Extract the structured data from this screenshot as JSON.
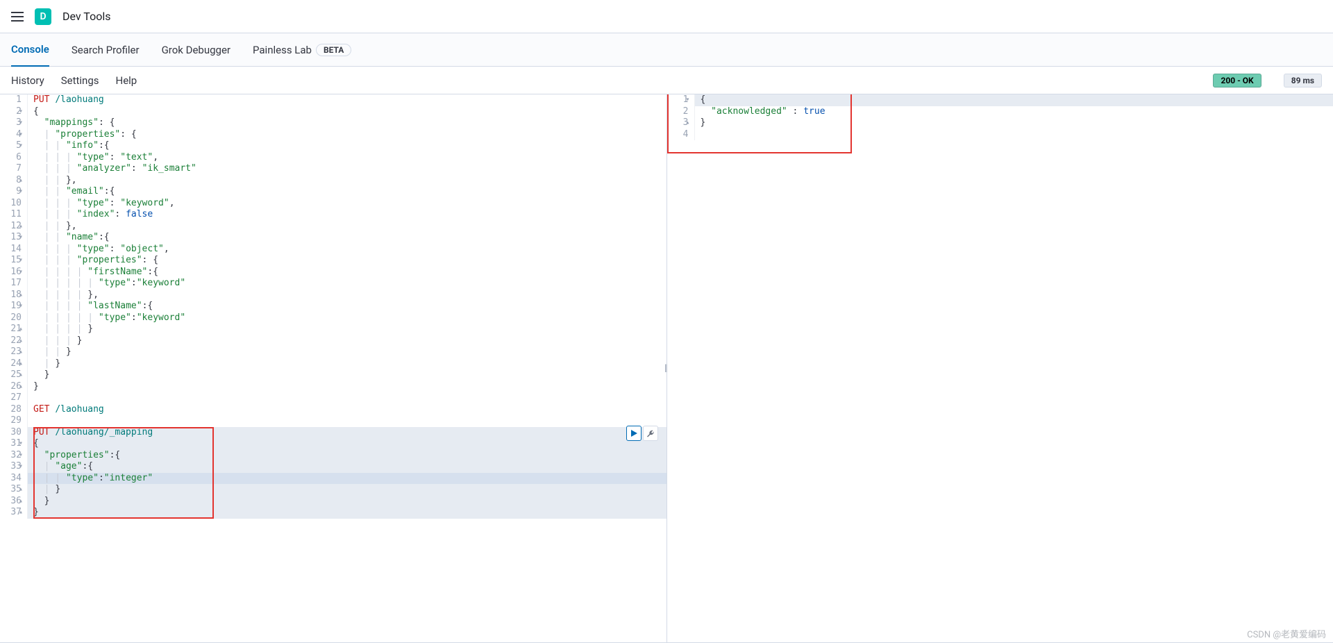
{
  "header": {
    "app_icon_letter": "D",
    "app_title": "Dev Tools"
  },
  "tabs": [
    {
      "label": "Console",
      "active": true
    },
    {
      "label": "Search Profiler",
      "active": false
    },
    {
      "label": "Grok Debugger",
      "active": false
    },
    {
      "label": "Painless Lab",
      "active": false,
      "badge": "BETA"
    }
  ],
  "subbar": {
    "history": "History",
    "settings": "Settings",
    "help": "Help",
    "status_label": "200 - OK",
    "timing_label": "89 ms"
  },
  "request_editor": {
    "highlight_start_line": 30,
    "highlight_end_line": 37,
    "current_line": 34,
    "lines": [
      {
        "n": 1,
        "fold": "",
        "tokens": [
          [
            "method",
            "PUT "
          ],
          [
            "path",
            "/laohuang"
          ]
        ]
      },
      {
        "n": 2,
        "fold": "▾",
        "tokens": [
          [
            "punct",
            "{"
          ]
        ]
      },
      {
        "n": 3,
        "fold": "▾",
        "tokens": [
          [
            "guide",
            "  "
          ],
          [
            "key",
            "\"mappings\""
          ],
          [
            "punct",
            ": {"
          ]
        ]
      },
      {
        "n": 4,
        "fold": "▾",
        "tokens": [
          [
            "guide",
            "  | "
          ],
          [
            "key",
            "\"properties\""
          ],
          [
            "punct",
            ": {"
          ]
        ]
      },
      {
        "n": 5,
        "fold": "▾",
        "tokens": [
          [
            "guide",
            "  | | "
          ],
          [
            "key",
            "\"info\""
          ],
          [
            "punct",
            ":{"
          ]
        ]
      },
      {
        "n": 6,
        "fold": "",
        "tokens": [
          [
            "guide",
            "  | | | "
          ],
          [
            "key",
            "\"type\""
          ],
          [
            "punct",
            ": "
          ],
          [
            "str",
            "\"text\""
          ],
          [
            "punct",
            ","
          ]
        ]
      },
      {
        "n": 7,
        "fold": "",
        "tokens": [
          [
            "guide",
            "  | | | "
          ],
          [
            "key",
            "\"analyzer\""
          ],
          [
            "punct",
            ": "
          ],
          [
            "str",
            "\"ik_smart\""
          ]
        ]
      },
      {
        "n": 8,
        "fold": "▴",
        "tokens": [
          [
            "guide",
            "  | | "
          ],
          [
            "punct",
            "},"
          ]
        ]
      },
      {
        "n": 9,
        "fold": "▾",
        "tokens": [
          [
            "guide",
            "  | | "
          ],
          [
            "key",
            "\"email\""
          ],
          [
            "punct",
            ":{"
          ]
        ]
      },
      {
        "n": 10,
        "fold": "",
        "tokens": [
          [
            "guide",
            "  | | | "
          ],
          [
            "key",
            "\"type\""
          ],
          [
            "punct",
            ": "
          ],
          [
            "str",
            "\"keyword\""
          ],
          [
            "punct",
            ","
          ]
        ]
      },
      {
        "n": 11,
        "fold": "",
        "tokens": [
          [
            "guide",
            "  | | | "
          ],
          [
            "key",
            "\"index\""
          ],
          [
            "punct",
            ": "
          ],
          [
            "bool",
            "false"
          ]
        ]
      },
      {
        "n": 12,
        "fold": "▴",
        "tokens": [
          [
            "guide",
            "  | | "
          ],
          [
            "punct",
            "},"
          ]
        ]
      },
      {
        "n": 13,
        "fold": "▾",
        "tokens": [
          [
            "guide",
            "  | | "
          ],
          [
            "key",
            "\"name\""
          ],
          [
            "punct",
            ":{"
          ]
        ]
      },
      {
        "n": 14,
        "fold": "",
        "tokens": [
          [
            "guide",
            "  | | | "
          ],
          [
            "key",
            "\"type\""
          ],
          [
            "punct",
            ": "
          ],
          [
            "str",
            "\"object\""
          ],
          [
            "punct",
            ","
          ]
        ]
      },
      {
        "n": 15,
        "fold": "▾",
        "tokens": [
          [
            "guide",
            "  | | | "
          ],
          [
            "key",
            "\"properties\""
          ],
          [
            "punct",
            ": {"
          ]
        ]
      },
      {
        "n": 16,
        "fold": "▾",
        "tokens": [
          [
            "guide",
            "  | | | | "
          ],
          [
            "key",
            "\"firstName\""
          ],
          [
            "punct",
            ":{"
          ]
        ]
      },
      {
        "n": 17,
        "fold": "",
        "tokens": [
          [
            "guide",
            "  | | | | | "
          ],
          [
            "key",
            "\"type\""
          ],
          [
            "punct",
            ":"
          ],
          [
            "str",
            "\"keyword\""
          ]
        ]
      },
      {
        "n": 18,
        "fold": "▴",
        "tokens": [
          [
            "guide",
            "  | | | | "
          ],
          [
            "punct",
            "},"
          ]
        ]
      },
      {
        "n": 19,
        "fold": "▾",
        "tokens": [
          [
            "guide",
            "  | | | | "
          ],
          [
            "key",
            "\"lastName\""
          ],
          [
            "punct",
            ":{"
          ]
        ]
      },
      {
        "n": 20,
        "fold": "",
        "tokens": [
          [
            "guide",
            "  | | | | | "
          ],
          [
            "key",
            "\"type\""
          ],
          [
            "punct",
            ":"
          ],
          [
            "str",
            "\"keyword\""
          ]
        ]
      },
      {
        "n": 21,
        "fold": "▴",
        "tokens": [
          [
            "guide",
            "  | | | | "
          ],
          [
            "punct",
            "}"
          ]
        ]
      },
      {
        "n": 22,
        "fold": "▴",
        "tokens": [
          [
            "guide",
            "  | | | "
          ],
          [
            "punct",
            "}"
          ]
        ]
      },
      {
        "n": 23,
        "fold": "▴",
        "tokens": [
          [
            "guide",
            "  | | "
          ],
          [
            "punct",
            "}"
          ]
        ]
      },
      {
        "n": 24,
        "fold": "▴",
        "tokens": [
          [
            "guide",
            "  | "
          ],
          [
            "punct",
            "}"
          ]
        ]
      },
      {
        "n": 25,
        "fold": "▴",
        "tokens": [
          [
            "guide",
            "  "
          ],
          [
            "punct",
            "}"
          ]
        ]
      },
      {
        "n": 26,
        "fold": "▴",
        "tokens": [
          [
            "punct",
            "}"
          ]
        ]
      },
      {
        "n": 27,
        "fold": "",
        "tokens": []
      },
      {
        "n": 28,
        "fold": "",
        "tokens": [
          [
            "method",
            "GET "
          ],
          [
            "path",
            "/laohuang"
          ]
        ]
      },
      {
        "n": 29,
        "fold": "",
        "tokens": []
      },
      {
        "n": 30,
        "fold": "",
        "tokens": [
          [
            "method",
            "PUT "
          ],
          [
            "path",
            "/laohuang/_mapping"
          ]
        ]
      },
      {
        "n": 31,
        "fold": "▾",
        "tokens": [
          [
            "punct",
            "{"
          ]
        ]
      },
      {
        "n": 32,
        "fold": "▾",
        "tokens": [
          [
            "guide",
            "  "
          ],
          [
            "key",
            "\"properties\""
          ],
          [
            "punct",
            ":{"
          ]
        ]
      },
      {
        "n": 33,
        "fold": "▾",
        "tokens": [
          [
            "guide",
            "  | "
          ],
          [
            "key",
            "\"age\""
          ],
          [
            "punct",
            ":{"
          ]
        ]
      },
      {
        "n": 34,
        "fold": "",
        "tokens": [
          [
            "guide",
            "  | | "
          ],
          [
            "key",
            "\"type\""
          ],
          [
            "punct",
            ":"
          ],
          [
            "str",
            "\"integer\""
          ]
        ]
      },
      {
        "n": 35,
        "fold": "▴",
        "tokens": [
          [
            "guide",
            "  | "
          ],
          [
            "punct",
            "}"
          ]
        ]
      },
      {
        "n": 36,
        "fold": "▴",
        "tokens": [
          [
            "guide",
            "  "
          ],
          [
            "punct",
            "}"
          ]
        ]
      },
      {
        "n": 37,
        "fold": "▴",
        "tokens": [
          [
            "punct",
            "}"
          ]
        ]
      }
    ]
  },
  "response_editor": {
    "highlight_current_line": 1,
    "lines": [
      {
        "n": 1,
        "fold": "▾",
        "tokens": [
          [
            "punct",
            "{"
          ]
        ]
      },
      {
        "n": 2,
        "fold": "",
        "tokens": [
          [
            "guide",
            "  "
          ],
          [
            "key",
            "\"acknowledged\""
          ],
          [
            "punct",
            " : "
          ],
          [
            "bool",
            "true"
          ]
        ]
      },
      {
        "n": 3,
        "fold": "▴",
        "tokens": [
          [
            "punct",
            "}"
          ]
        ]
      },
      {
        "n": 4,
        "fold": "",
        "tokens": []
      }
    ]
  },
  "watermark": "CSDN @老黄爱编码"
}
